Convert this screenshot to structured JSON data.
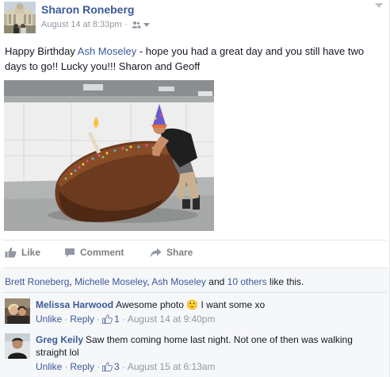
{
  "post": {
    "author": "Sharon Roneberg",
    "timestamp": "August 14 at 8:33pm",
    "audience_icon": "friends-icon",
    "text_before": "Happy Birthday ",
    "text_mention": "Ash Moseley",
    "text_after": " - hope you had a great day and you still have two days to go!! Lucky you!!! Sharon and Geoff",
    "photo_description_icon": "photo"
  },
  "actions": {
    "like_label": "Like",
    "comment_label": "Comment",
    "share_label": "Share"
  },
  "likes": {
    "name1": "Brett Roneberg",
    "sep1": ", ",
    "name2": "Michelle Moseley",
    "sep2": ", ",
    "name3": "Ash Moseley",
    "and": " and ",
    "others": "10 others",
    "suffix": " like this."
  },
  "comments": [
    {
      "author": "Melissa Harwood",
      "text_before": "Awesome photo ",
      "emoji": "🙂",
      "text_after": " I want some xo",
      "unlike_label": "Unlike",
      "reply_label": "Reply",
      "like_count": "1",
      "time": "August 14 at 9:40pm"
    },
    {
      "author": "Greg Keily",
      "text": "Saw them coming home last night. Not one of then was walking straight lol",
      "unlike_label": "Unlike",
      "reply_label": "Reply",
      "like_count": "3",
      "time": "August 15 at 6:13am"
    }
  ],
  "colors": {
    "link": "#3b5998",
    "meta": "#9197a3",
    "likes_bg": "#f6f7f9"
  }
}
